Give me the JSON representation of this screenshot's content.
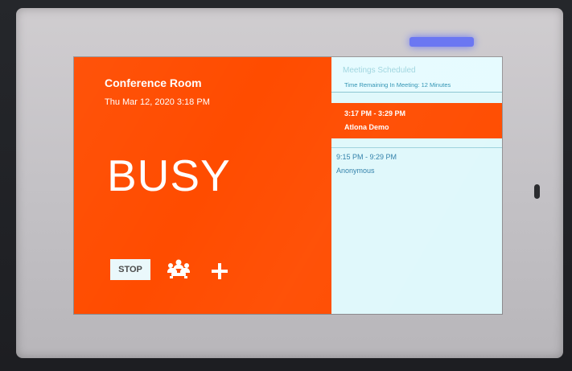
{
  "device": {
    "led_color": "#4b5cff"
  },
  "room": {
    "name": "Conference Room",
    "datetime": "Thu Mar 12, 2020 3:18 PM",
    "status": "BUSY"
  },
  "controls": {
    "stop_label": "STOP",
    "attendees_icon": "people-icon",
    "add_icon": "plus-icon"
  },
  "meetings": {
    "heading": "Meetings Scheduled",
    "time_remaining": "Time Remaining In Meeting: 12 Minutes",
    "items": [
      {
        "time": "3:17 PM - 3:29 PM",
        "title": "Atlona Demo",
        "state": "active"
      },
      {
        "time": "9:15 PM - 9:29 PM",
        "title": "Anonymous",
        "state": "inactive"
      }
    ]
  },
  "colors": {
    "busy": "#ff4c00",
    "right_panel": "#dff8fb",
    "accent_blue": "#2f7fa9"
  }
}
